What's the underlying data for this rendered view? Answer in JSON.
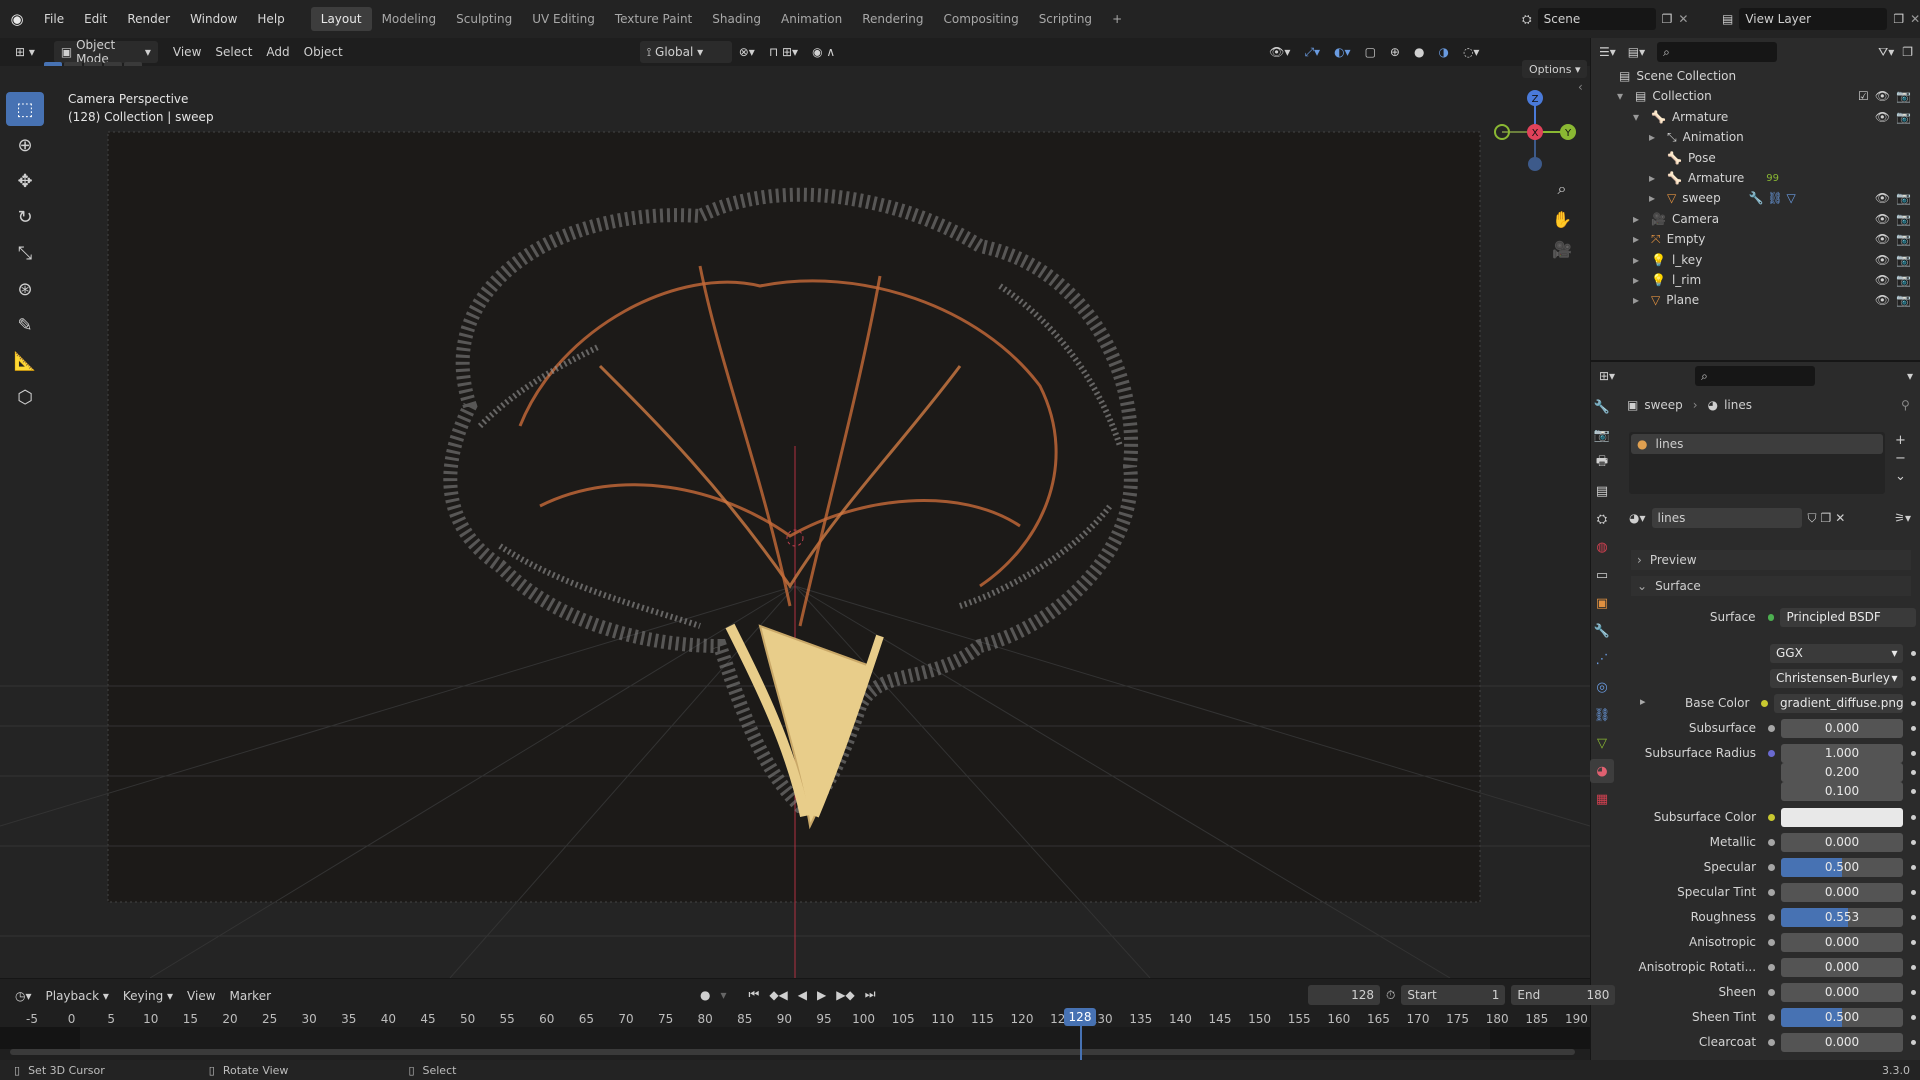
{
  "menu": {
    "items": [
      "File",
      "Edit",
      "Render",
      "Window",
      "Help"
    ]
  },
  "workspaces": {
    "tabs": [
      "Layout",
      "Modeling",
      "Sculpting",
      "UV Editing",
      "Texture Paint",
      "Shading",
      "Animation",
      "Rendering",
      "Compositing",
      "Scripting"
    ],
    "add": "+"
  },
  "scene": {
    "name": "Scene",
    "view_layer": "View Layer"
  },
  "viewport_header": {
    "mode": "Object Mode",
    "view": "View",
    "select": "Select",
    "add": "Add",
    "object": "Object",
    "orientation": "Global",
    "options": "Options"
  },
  "viewport": {
    "perspective": "Camera Perspective",
    "collection_label": "(128) Collection | sweep"
  },
  "gizmo": {
    "z": "Z",
    "x": "X",
    "y": "Y"
  },
  "outliner": {
    "items": [
      {
        "label": "Scene Collection",
        "indent": 0
      },
      {
        "label": "Collection",
        "indent": 1
      },
      {
        "label": "Armature",
        "indent": 2
      },
      {
        "label": "Animation",
        "indent": 3
      },
      {
        "label": "Pose",
        "indent": 3
      },
      {
        "label": "Armature",
        "indent": 3
      },
      {
        "label": "sweep",
        "indent": 3
      },
      {
        "label": "Camera",
        "indent": 2
      },
      {
        "label": "Empty",
        "indent": 2
      },
      {
        "label": "l_key",
        "indent": 2
      },
      {
        "label": "l_rim",
        "indent": 2
      },
      {
        "label": "Plane",
        "indent": 2
      }
    ],
    "bone_count": "99"
  },
  "properties": {
    "breadcrumb_object": "sweep",
    "breadcrumb_material": "lines",
    "slot_name": "lines",
    "material_name": "lines",
    "preview": "Preview",
    "surface_panel": "Surface",
    "surface_label": "Surface",
    "surface_value": "Principled BSDF",
    "distribution": "GGX",
    "subsurface_method": "Christensen-Burley",
    "rows": [
      {
        "label": "Base Color",
        "value": "gradient_diffuse.png",
        "fill": 0
      },
      {
        "label": "Subsurface",
        "value": "0.000",
        "fill": 0
      },
      {
        "label": "Subsurface Radius",
        "value": "1.000",
        "fill": 0
      },
      {
        "label": "",
        "value": "0.200",
        "fill": 0
      },
      {
        "label": "",
        "value": "0.100",
        "fill": 0
      },
      {
        "label": "Subsurface Color",
        "value": "",
        "fill": 0
      },
      {
        "label": "Metallic",
        "value": "0.000",
        "fill": 0
      },
      {
        "label": "Specular",
        "value": "0.500",
        "fill": 0.5
      },
      {
        "label": "Specular Tint",
        "value": "0.000",
        "fill": 0
      },
      {
        "label": "Roughness",
        "value": "0.553",
        "fill": 0.553
      },
      {
        "label": "Anisotropic",
        "value": "0.000",
        "fill": 0
      },
      {
        "label": "Anisotropic Rotati...",
        "value": "0.000",
        "fill": 0
      },
      {
        "label": "Sheen",
        "value": "0.000",
        "fill": 0
      },
      {
        "label": "Sheen Tint",
        "value": "0.500",
        "fill": 0.5
      },
      {
        "label": "Clearcoat",
        "value": "0.000",
        "fill": 0
      }
    ]
  },
  "timeline": {
    "playback": "Playback",
    "keying": "Keying",
    "view": "View",
    "marker": "Marker",
    "current_frame": "128",
    "start_label": "Start",
    "start": "1",
    "end_label": "End",
    "end": "180",
    "ticks": [
      "-5",
      "0",
      "5",
      "10",
      "15",
      "20",
      "25",
      "30",
      "35",
      "40",
      "45",
      "50",
      "55",
      "60",
      "65",
      "70",
      "75",
      "80",
      "85",
      "90",
      "95",
      "100",
      "105",
      "110",
      "115",
      "120",
      "125",
      "130",
      "135",
      "140",
      "145",
      "150",
      "155",
      "160",
      "165",
      "170",
      "175",
      "180",
      "185",
      "190"
    ]
  },
  "status": {
    "left": "Set 3D Cursor",
    "middle": "Rotate View",
    "right": "Select",
    "version": "3.3.0"
  },
  "colors": {
    "accent": "#4772b3",
    "orange": "#e07a3a",
    "axis_x": "#e0425a",
    "axis_y": "#8ab833",
    "axis_z": "#4a7ad9"
  }
}
